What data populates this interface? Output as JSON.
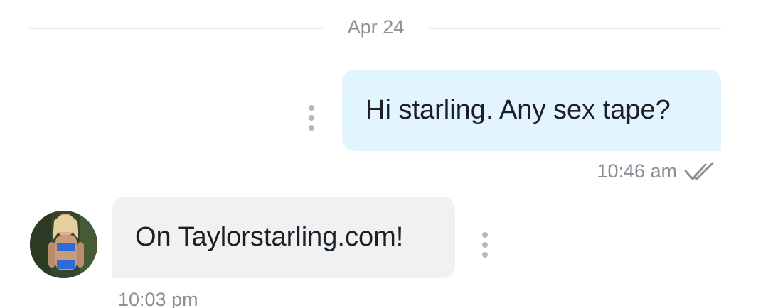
{
  "divider": {
    "date": "Apr 24"
  },
  "messages": {
    "outgoing": {
      "text": "Hi starling. Any sex tape?",
      "time": "10:46 am",
      "status_icon": "double-check-icon"
    },
    "incoming": {
      "text": "On Taylorstarling.com!",
      "time": "10:03 pm",
      "avatar_icon": "avatar"
    }
  },
  "colors": {
    "outgoing_bubble": "#e2f4fd",
    "incoming_bubble": "#f0f1f3",
    "meta_text": "#8a8f98",
    "message_text": "#1d2023"
  }
}
